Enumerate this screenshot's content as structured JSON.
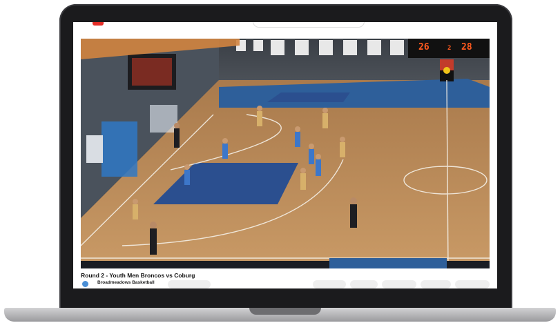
{
  "video": {
    "title": "Round 2 - Youth Men Broncos vs Coburg",
    "channel_name": "Broadmeadows Basketball",
    "scoreboard": {
      "home": "26",
      "period": "2",
      "away": "28"
    }
  },
  "icons": {
    "logo": "youtube-logo-icon",
    "avatar": "channel-avatar"
  },
  "colors": {
    "court_wood": "#c08a55",
    "paint_blue": "#2b4f8f",
    "scoreboard_digits": "#ff5a1f",
    "brand_red": "#e52d27"
  }
}
